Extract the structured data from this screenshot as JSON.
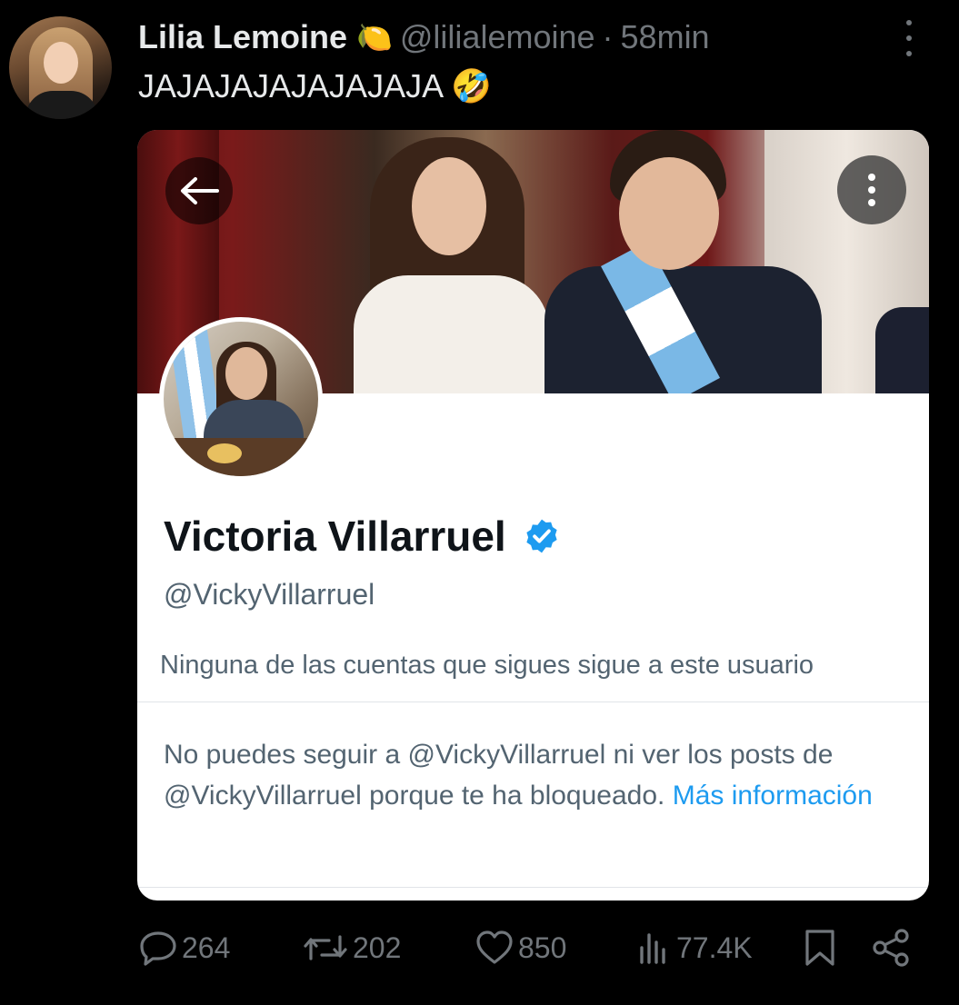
{
  "post": {
    "author_name": "Lilia Lemoine",
    "author_emoji": "🍋",
    "author_handle": "@lilialemoine",
    "separator": "·",
    "time": "58min",
    "text": "JAJAJAJAJAJAJAJA 🤣"
  },
  "card": {
    "profile_name": "Victoria Villarruel",
    "profile_handle": "@VickyVillarruel",
    "follow_note": "Ninguna de las cuentas que sigues sigue a este usuario",
    "blocked_text": "No puedes seguir a @VickyVillarruel ni ver los posts de @VickyVillarruel porque te ha bloqueado.",
    "more_info_link": "Más información"
  },
  "actions": {
    "replies": "264",
    "reposts": "202",
    "likes": "850",
    "views": "77.4K"
  },
  "colors": {
    "background": "#000000",
    "link_blue": "#1d9bf0",
    "muted_gray": "#71767b",
    "verified_blue": "#1d9bf0"
  },
  "icons": [
    "more-vertical-icon",
    "arrow-left-icon",
    "verified-badge-icon",
    "reply-icon",
    "repost-icon",
    "like-icon",
    "views-icon",
    "bookmark-icon",
    "share-icon"
  ]
}
